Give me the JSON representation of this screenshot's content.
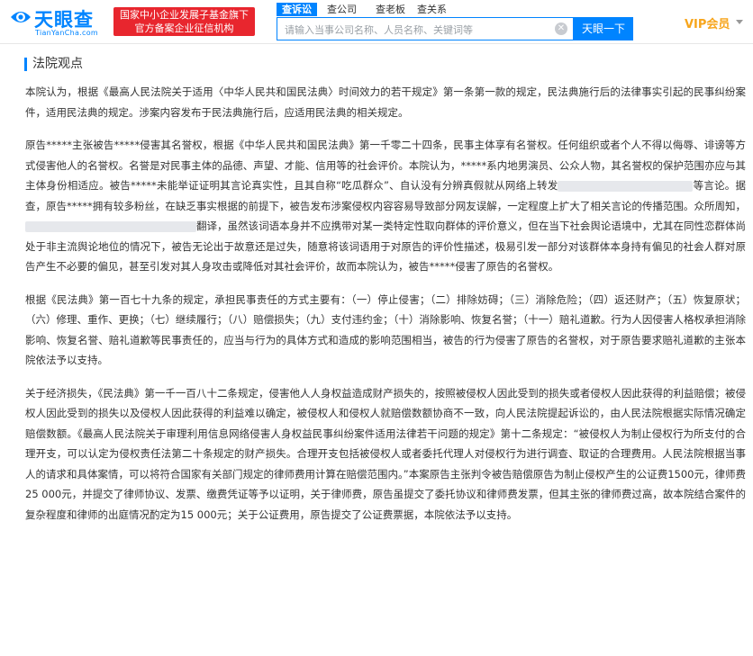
{
  "header": {
    "logo_text": "天眼查",
    "logo_domain": "TianYanCha.com",
    "badge_line1": "国家中小企业发展子基金旗下",
    "badge_line2": "官方备案企业征信机构",
    "tabs": [
      {
        "label": "查诉讼",
        "active": true
      },
      {
        "label": "查公司",
        "active": false
      },
      {
        "label": "查老板",
        "active": false
      },
      {
        "label": "查关系",
        "active": false
      }
    ],
    "search_placeholder": "请输入当事公司名称、人员名称、关键词等",
    "search_button": "天眼一下",
    "vip_label": "VIP会员",
    "accent_color": "#0084ff",
    "badge_color": "#e8262e",
    "vip_color": "#f7a51c"
  },
  "section": {
    "title": "法院观点"
  },
  "paragraphs": {
    "p1": "本院认为，根据《最高人民法院关于适用〈中华人民共和国民法典〉时间效力的若干规定》第一条第一款的规定，民法典施行后的法律事实引起的民事纠纷案件，适用民法典的规定。涉案内容发布于民法典施行后，应适用民法典的相关规定。",
    "p2a": "原告*****主张被告*****侵害其名誉权，根据《中华人民共和国民法典》第一千零二十四条，民事主体享有名誉权。任何组织或者个人不得以侮辱、诽谤等方式侵害他人的名誉权。名誉是对民事主体的品德、声望、才能、信用等的社会评价。本院认为，*****系内地男演员、公众人物，其名誉权的保护范围亦应与其主体身份相适应。被告*****未能举证证明其言论真实性，且其自称“吃瓜群众”、自认没有分辨真假就从网络上转发",
    "p2b": "等言论。据查，原告*****拥有较多粉丝，在缺乏事实根据的前提下，被告发布涉案侵权内容容易导致部分网友误解，一定程度上扩大了相关言论的传播范围。众所周知，",
    "p2c": "翻译，虽然该词语本身并不应携带对某一类特定性取向群体的评价意义，但在当下社会舆论语境中，尤其在同性恋群体尚处于非主流舆论地位的情况下，被告无论出于故意还是过失，随意将该词语用于对原告的评价性描述，极易引发一部分对该群体本身持有偏见的社会人群对原告产生不必要的偏见，甚至引发对其人身攻击或降低对其社会评价，故而本院认为，被告*****侵害了原告的名誉权。",
    "p3": "根据《民法典》第一百七十九条的规定，承担民事责任的方式主要有：（一）停止侵害；（二）排除妨碍；（三）消除危险；（四）返还财产；（五）恢复原状；（六）修理、重作、更换；（七）继续履行；（八）赔偿损失；（九）支付违约金；（十）消除影响、恢复名誉；（十一）赔礼道歉。行为人因侵害人格权承担消除影响、恢复名誉、赔礼道歉等民事责任的，应当与行为的具体方式和造成的影响范围相当，被告的行为侵害了原告的名誉权，对于原告要求赔礼道歉的主张本院依法予以支持。",
    "p4": "关于经济损失，《民法典》第一千一百八十二条规定，侵害他人人身权益造成财产损失的，按照被侵权人因此受到的损失或者侵权人因此获得的利益赔偿；被侵权人因此受到的损失以及侵权人因此获得的利益难以确定，被侵权人和侵权人就赔偿数额协商不一致，向人民法院提起诉讼的，由人民法院根据实际情况确定赔偿数额。《最高人民法院关于审理利用信息网络侵害人身权益民事纠纷案件适用法律若干问题的规定》第十二条规定：“被侵权人为制止侵权行为所支付的合理开支，可以认定为侵权责任法第二十条规定的财产损失。合理开支包括被侵权人或者委托代理人对侵权行为进行调查、取证的合理费用。人民法院根据当事人的请求和具体案情，可以将符合国家有关部门规定的律师费用计算在赔偿范围内。”本案原告主张判令被告赔偿原告为制止侵权产生的公证费1500元，律师费25 000元，并提交了律师协议、发票、缴费凭证等予以证明，关于律师费，原告虽提交了委托协议和律师费发票，但其主张的律师费过高，故本院结合案件的复杂程度和律师的出庭情况酌定为15 000元；关于公证费用，原告提交了公证费票据，本院依法予以支持。"
  }
}
